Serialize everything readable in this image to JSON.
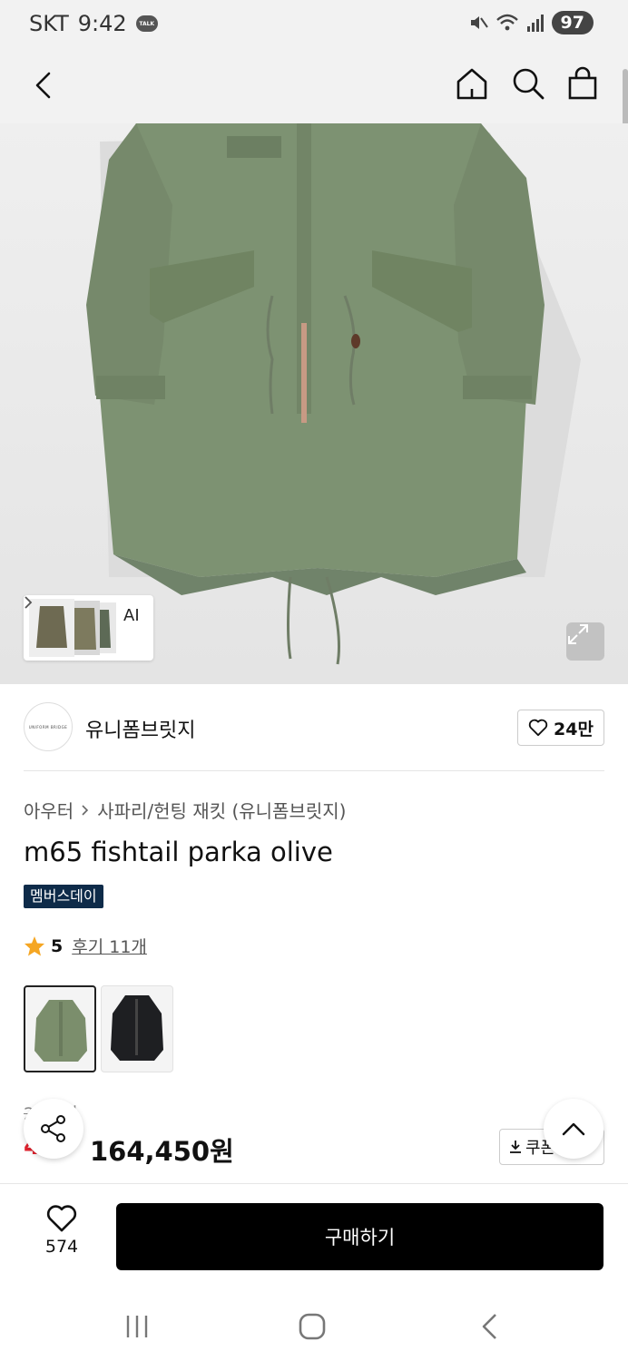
{
  "status_bar": {
    "carrier": "SKT",
    "time": "9:42",
    "talk_badge": "TALK",
    "battery": "97"
  },
  "gallery": {
    "ai_label": "AI"
  },
  "brand": {
    "name": "유니폼브릿지",
    "logo_text": "UNIFORM BRIDGE",
    "likes": "24만"
  },
  "breadcrumb": {
    "category": "아우터",
    "subcategory": "사파리/헌팅 재킷 (유니폼브릿지)"
  },
  "product": {
    "title": "m65 fishtail parka olive",
    "badge": "멤버스데이",
    "rating": "5",
    "review_link": "후기 11개",
    "variants": [
      {
        "name": "olive",
        "color": "#7b8e6c"
      },
      {
        "name": "black",
        "color": "#1e1f22"
      }
    ],
    "original_price": "2  90원",
    "discount": "4  ",
    "price": "164,450원",
    "coupon_label": "쿠폰"
  },
  "bottom_bar": {
    "wish_count": "574",
    "buy_label": "구매하기"
  },
  "colors": {
    "jacket": "#7d9272",
    "jacket_shadow": "#6a7d60",
    "badge_bg": "#0e2b49",
    "discount_red": "#e4232f"
  }
}
